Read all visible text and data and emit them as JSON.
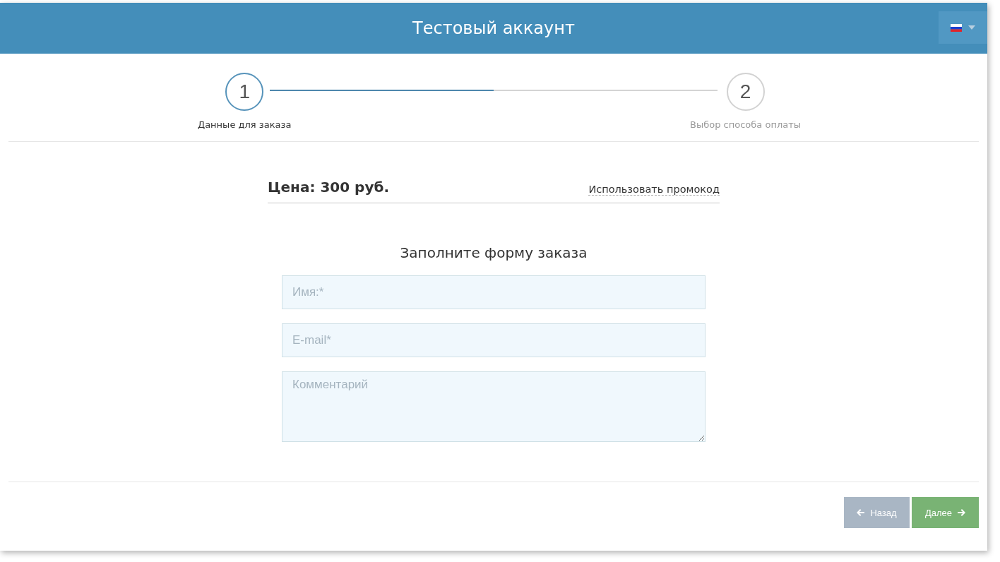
{
  "header": {
    "title": "Тестовый аккаунт"
  },
  "steps": [
    {
      "number": "1",
      "label": "Данные для заказа",
      "selected": true
    },
    {
      "number": "2",
      "label": "Выбор способа оплаты",
      "selected": false
    }
  ],
  "price": "Цена: 300 руб.",
  "promo_link": "Использовать промокод",
  "form": {
    "heading": "Заполните форму заказа",
    "fields": [
      {
        "kind": "input",
        "placeholder": "Имя:*"
      },
      {
        "kind": "input",
        "placeholder": "E-mail*"
      },
      {
        "kind": "textarea",
        "placeholder": "Комментарий"
      }
    ]
  },
  "buttons": [
    {
      "kind": "back",
      "label": "Назад",
      "disabled": true
    },
    {
      "kind": "next",
      "label": "Далее",
      "disabled": false
    }
  ]
}
